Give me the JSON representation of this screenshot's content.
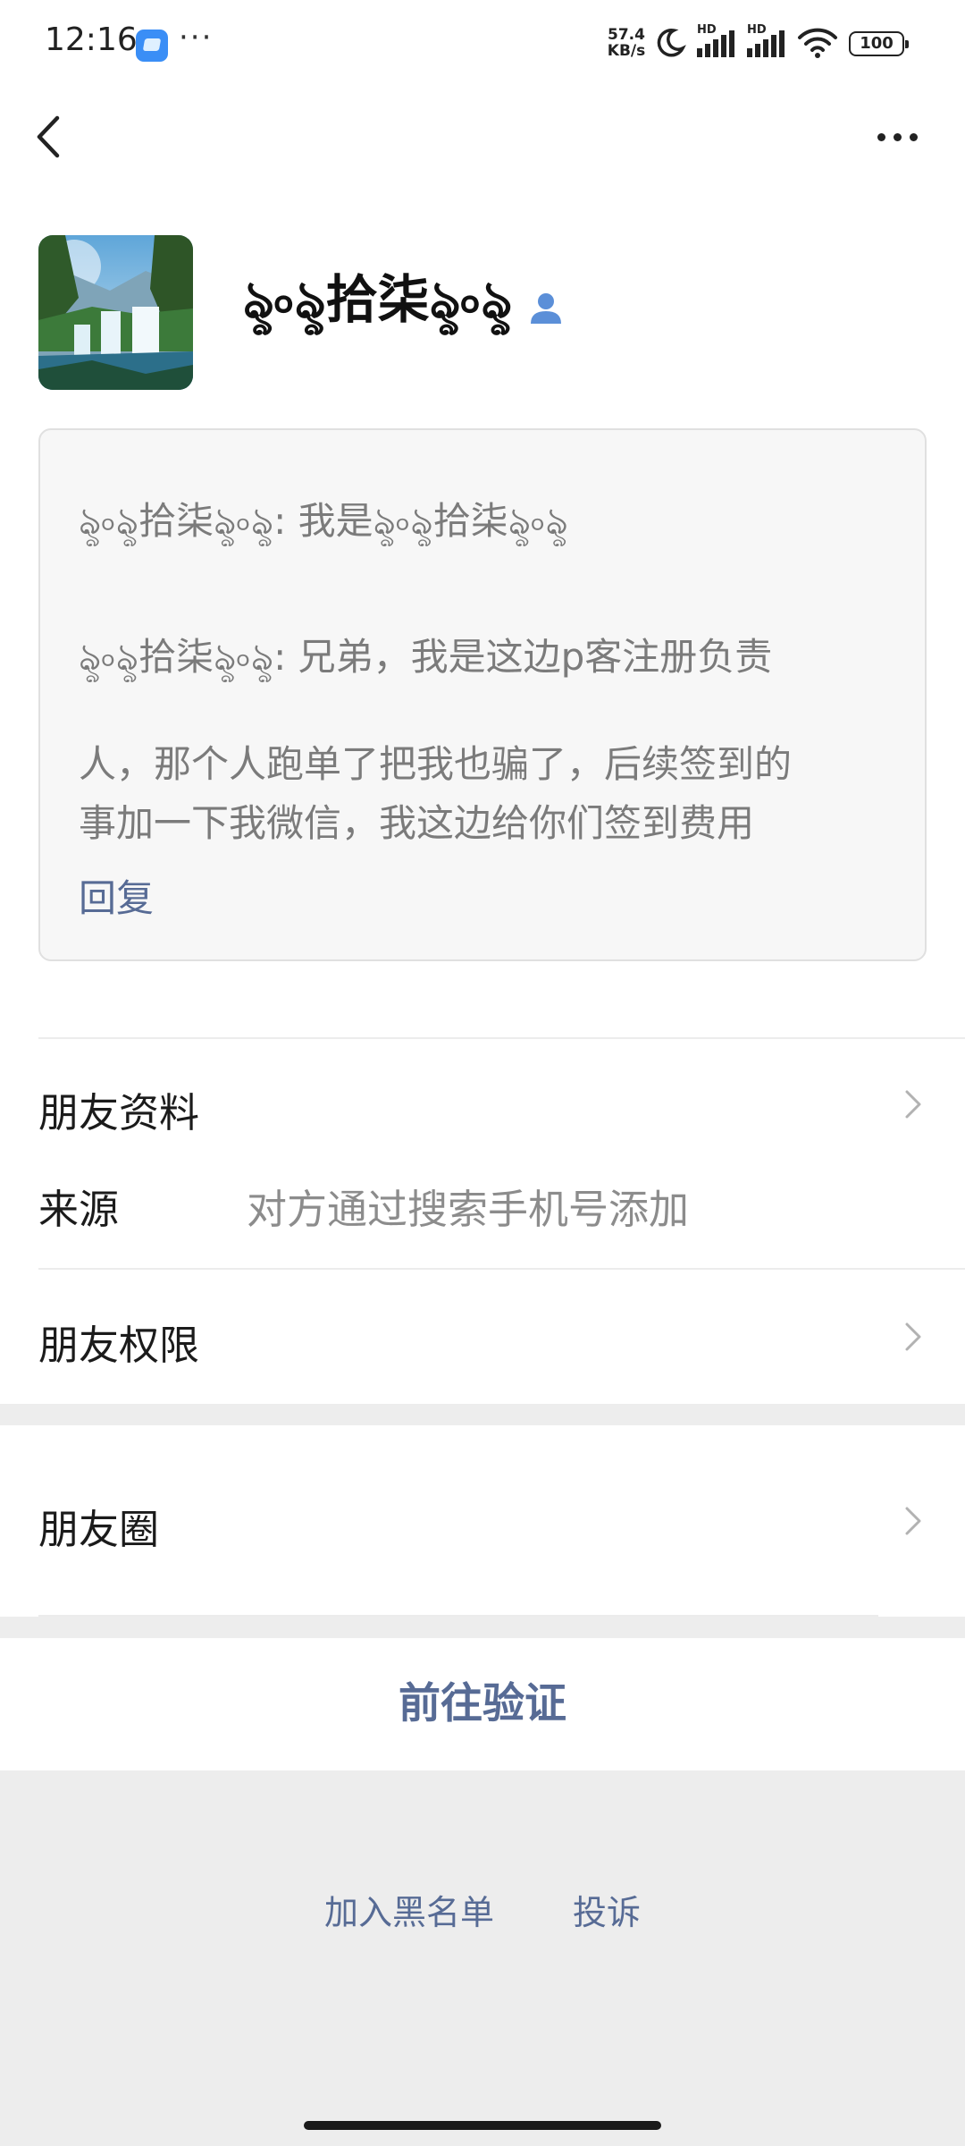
{
  "status_bar": {
    "time": "12:16",
    "more": "···",
    "net_speed_value": "57.4",
    "net_speed_unit": "KB/s",
    "signal_1_label": "HD",
    "signal_2_label": "HD",
    "battery": "100",
    "app_icon": "chat-app-icon",
    "moon_icon": "moon-icon",
    "wifi_icon": "wifi-icon"
  },
  "nav": {
    "back_icon": "chevron-left-icon",
    "more_icon": "more-dots-icon"
  },
  "profile": {
    "nickname": "ৡ৹ৡ拾柒ৡ৹ৡ",
    "contact_icon": "person-icon"
  },
  "message": {
    "lines": [
      "ৡ৹ৡ拾柒ৡ৹ৡ: 我是ৡ৹ৡ拾柒ৡ৹ৡ",
      "ৡ৹ৡ拾柒ৡ৹ৡ: 兄弟，我是这边p客注册负责",
      "人，那个人跑单了把我也骗了，后续签到的",
      "事加一下我微信，我这边给你们签到费用"
    ],
    "reply_label": "回复"
  },
  "list": {
    "friend_profile_label": "朋友资料",
    "source_label": "来源",
    "source_value": "对方通过搜索手机号添加",
    "friend_permissions_label": "朋友权限",
    "moments_label": "朋友圈"
  },
  "actions": {
    "verify_label": "前往验证",
    "blacklist_label": "加入黑名单",
    "report_label": "投诉"
  },
  "colors": {
    "link_blue": "#576b95",
    "gray_text": "#7b7b7b",
    "gap_gray": "#ededed"
  }
}
